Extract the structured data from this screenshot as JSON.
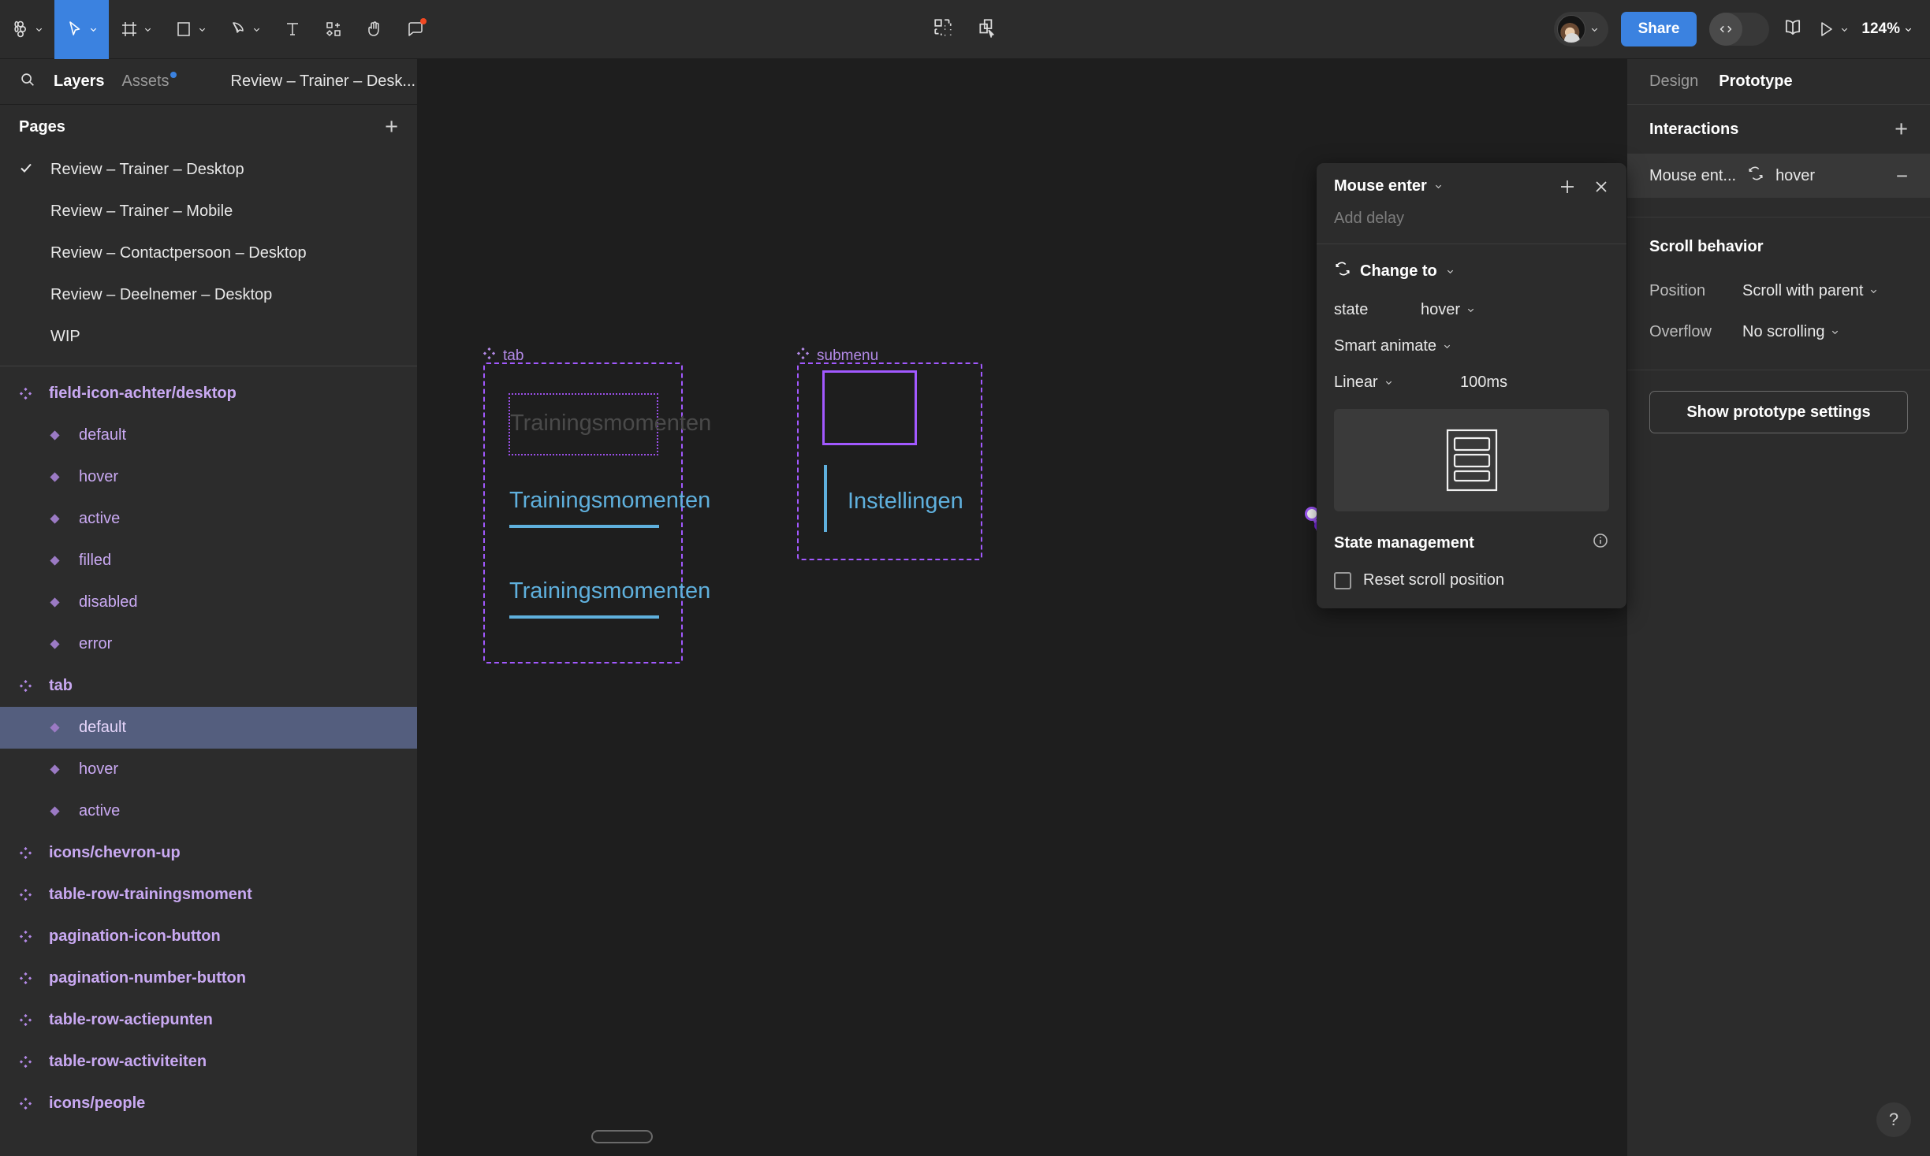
{
  "toolbar": {
    "menu_icon": "figma-logo-icon",
    "tools": [
      {
        "name": "move-tool",
        "icon": "cursor-icon",
        "active": true
      },
      {
        "name": "frame-tool",
        "icon": "frame-icon",
        "active": false
      },
      {
        "name": "shape-tool",
        "icon": "square-icon",
        "active": false
      },
      {
        "name": "pen-tool",
        "icon": "pen-icon",
        "active": false
      },
      {
        "name": "text-tool",
        "icon": "text-icon",
        "active": false
      },
      {
        "name": "resources-tool",
        "icon": "components-icon",
        "active": false
      },
      {
        "name": "hand-tool",
        "icon": "hand-icon",
        "active": false
      },
      {
        "name": "comment-tool",
        "icon": "comment-icon",
        "active": false
      }
    ],
    "center_icons": [
      "grid-view-icon",
      "duplicate-layers-icon"
    ],
    "share_label": "Share",
    "devmode_icon": "code-icon",
    "book_icon": "book-icon",
    "present_icon": "play-icon",
    "zoom_level": "124%"
  },
  "left_panel": {
    "search_icon": "search-icon",
    "tabs": [
      {
        "label": "Layers",
        "active": true
      },
      {
        "label": "Assets",
        "active": false,
        "dot": true
      }
    ],
    "file_name": "Review – Trainer – Desk...",
    "pages_title": "Pages",
    "pages_add_label": "+",
    "pages": [
      {
        "label": "Review – Trainer – Desktop",
        "current": true
      },
      {
        "label": "Review – Trainer – Mobile",
        "current": false
      },
      {
        "label": "Review – Contactpersoon – Desktop",
        "current": false
      },
      {
        "label": "Review – Deelnemer – Desktop",
        "current": false
      },
      {
        "label": "WIP",
        "current": false
      }
    ],
    "layers": [
      {
        "label": "field-icon-achter/desktop",
        "type": "component",
        "selected": false
      },
      {
        "label": "default",
        "type": "variant",
        "selected": false
      },
      {
        "label": "hover",
        "type": "variant",
        "selected": false
      },
      {
        "label": "active",
        "type": "variant",
        "selected": false
      },
      {
        "label": "filled",
        "type": "variant",
        "selected": false
      },
      {
        "label": "disabled",
        "type": "variant",
        "selected": false
      },
      {
        "label": "error",
        "type": "variant",
        "selected": false
      },
      {
        "label": "tab",
        "type": "component",
        "selected": false
      },
      {
        "label": "default",
        "type": "variant",
        "selected": true
      },
      {
        "label": "hover",
        "type": "variant",
        "selected": false
      },
      {
        "label": "active",
        "type": "variant",
        "selected": false
      },
      {
        "label": "icons/chevron-up",
        "type": "component",
        "selected": false
      },
      {
        "label": "table-row-trainingsmoment",
        "type": "component",
        "selected": false
      },
      {
        "label": "pagination-icon-button",
        "type": "component",
        "selected": false
      },
      {
        "label": "pagination-number-button",
        "type": "component",
        "selected": false
      },
      {
        "label": "table-row-actiepunten",
        "type": "component",
        "selected": false
      },
      {
        "label": "table-row-activiteiten",
        "type": "component",
        "selected": false
      },
      {
        "label": "icons/people",
        "type": "component",
        "selected": false
      }
    ]
  },
  "canvas": {
    "frames": [
      {
        "label": "tab",
        "texts": [
          "Trainingsmomenten",
          "Trainingsmomenten",
          "Trainingsmomenten"
        ]
      },
      {
        "label": "submenu",
        "texts": [
          "Instellingen"
        ]
      }
    ],
    "accent_blue": "#5fb0dd",
    "selection_purple": "#a259ff",
    "cursor_badge": "+"
  },
  "interaction_popup": {
    "trigger_label": "Mouse enter",
    "add_icon": "plus-icon",
    "close_icon": "close-icon",
    "delay_placeholder": "Add delay",
    "action_icon": "change-to-icon",
    "action_label": "Change to",
    "state_label": "state",
    "state_value": "hover",
    "animation_value": "Smart animate",
    "easing_value": "Linear",
    "duration_value": "100ms",
    "preview_icon": "list-frame-preview-icon",
    "state_management_label": "State management",
    "info_icon": "info-icon",
    "reset_scroll_label": "Reset scroll position",
    "reset_scroll_checked": false
  },
  "right_panel": {
    "tabs": [
      {
        "label": "Design",
        "active": false
      },
      {
        "label": "Prototype",
        "active": true
      }
    ],
    "interactions_title": "Interactions",
    "add_label": "+",
    "interaction": {
      "trigger": "Mouse ent...",
      "action_icon": "change-to-icon",
      "destination": "hover",
      "remove_label": "−"
    },
    "scroll_behavior_title": "Scroll behavior",
    "position_label": "Position",
    "position_value": "Scroll with parent",
    "overflow_label": "Overflow",
    "overflow_value": "No scrolling",
    "show_prototype_settings_label": "Show prototype settings",
    "help_label": "?"
  }
}
